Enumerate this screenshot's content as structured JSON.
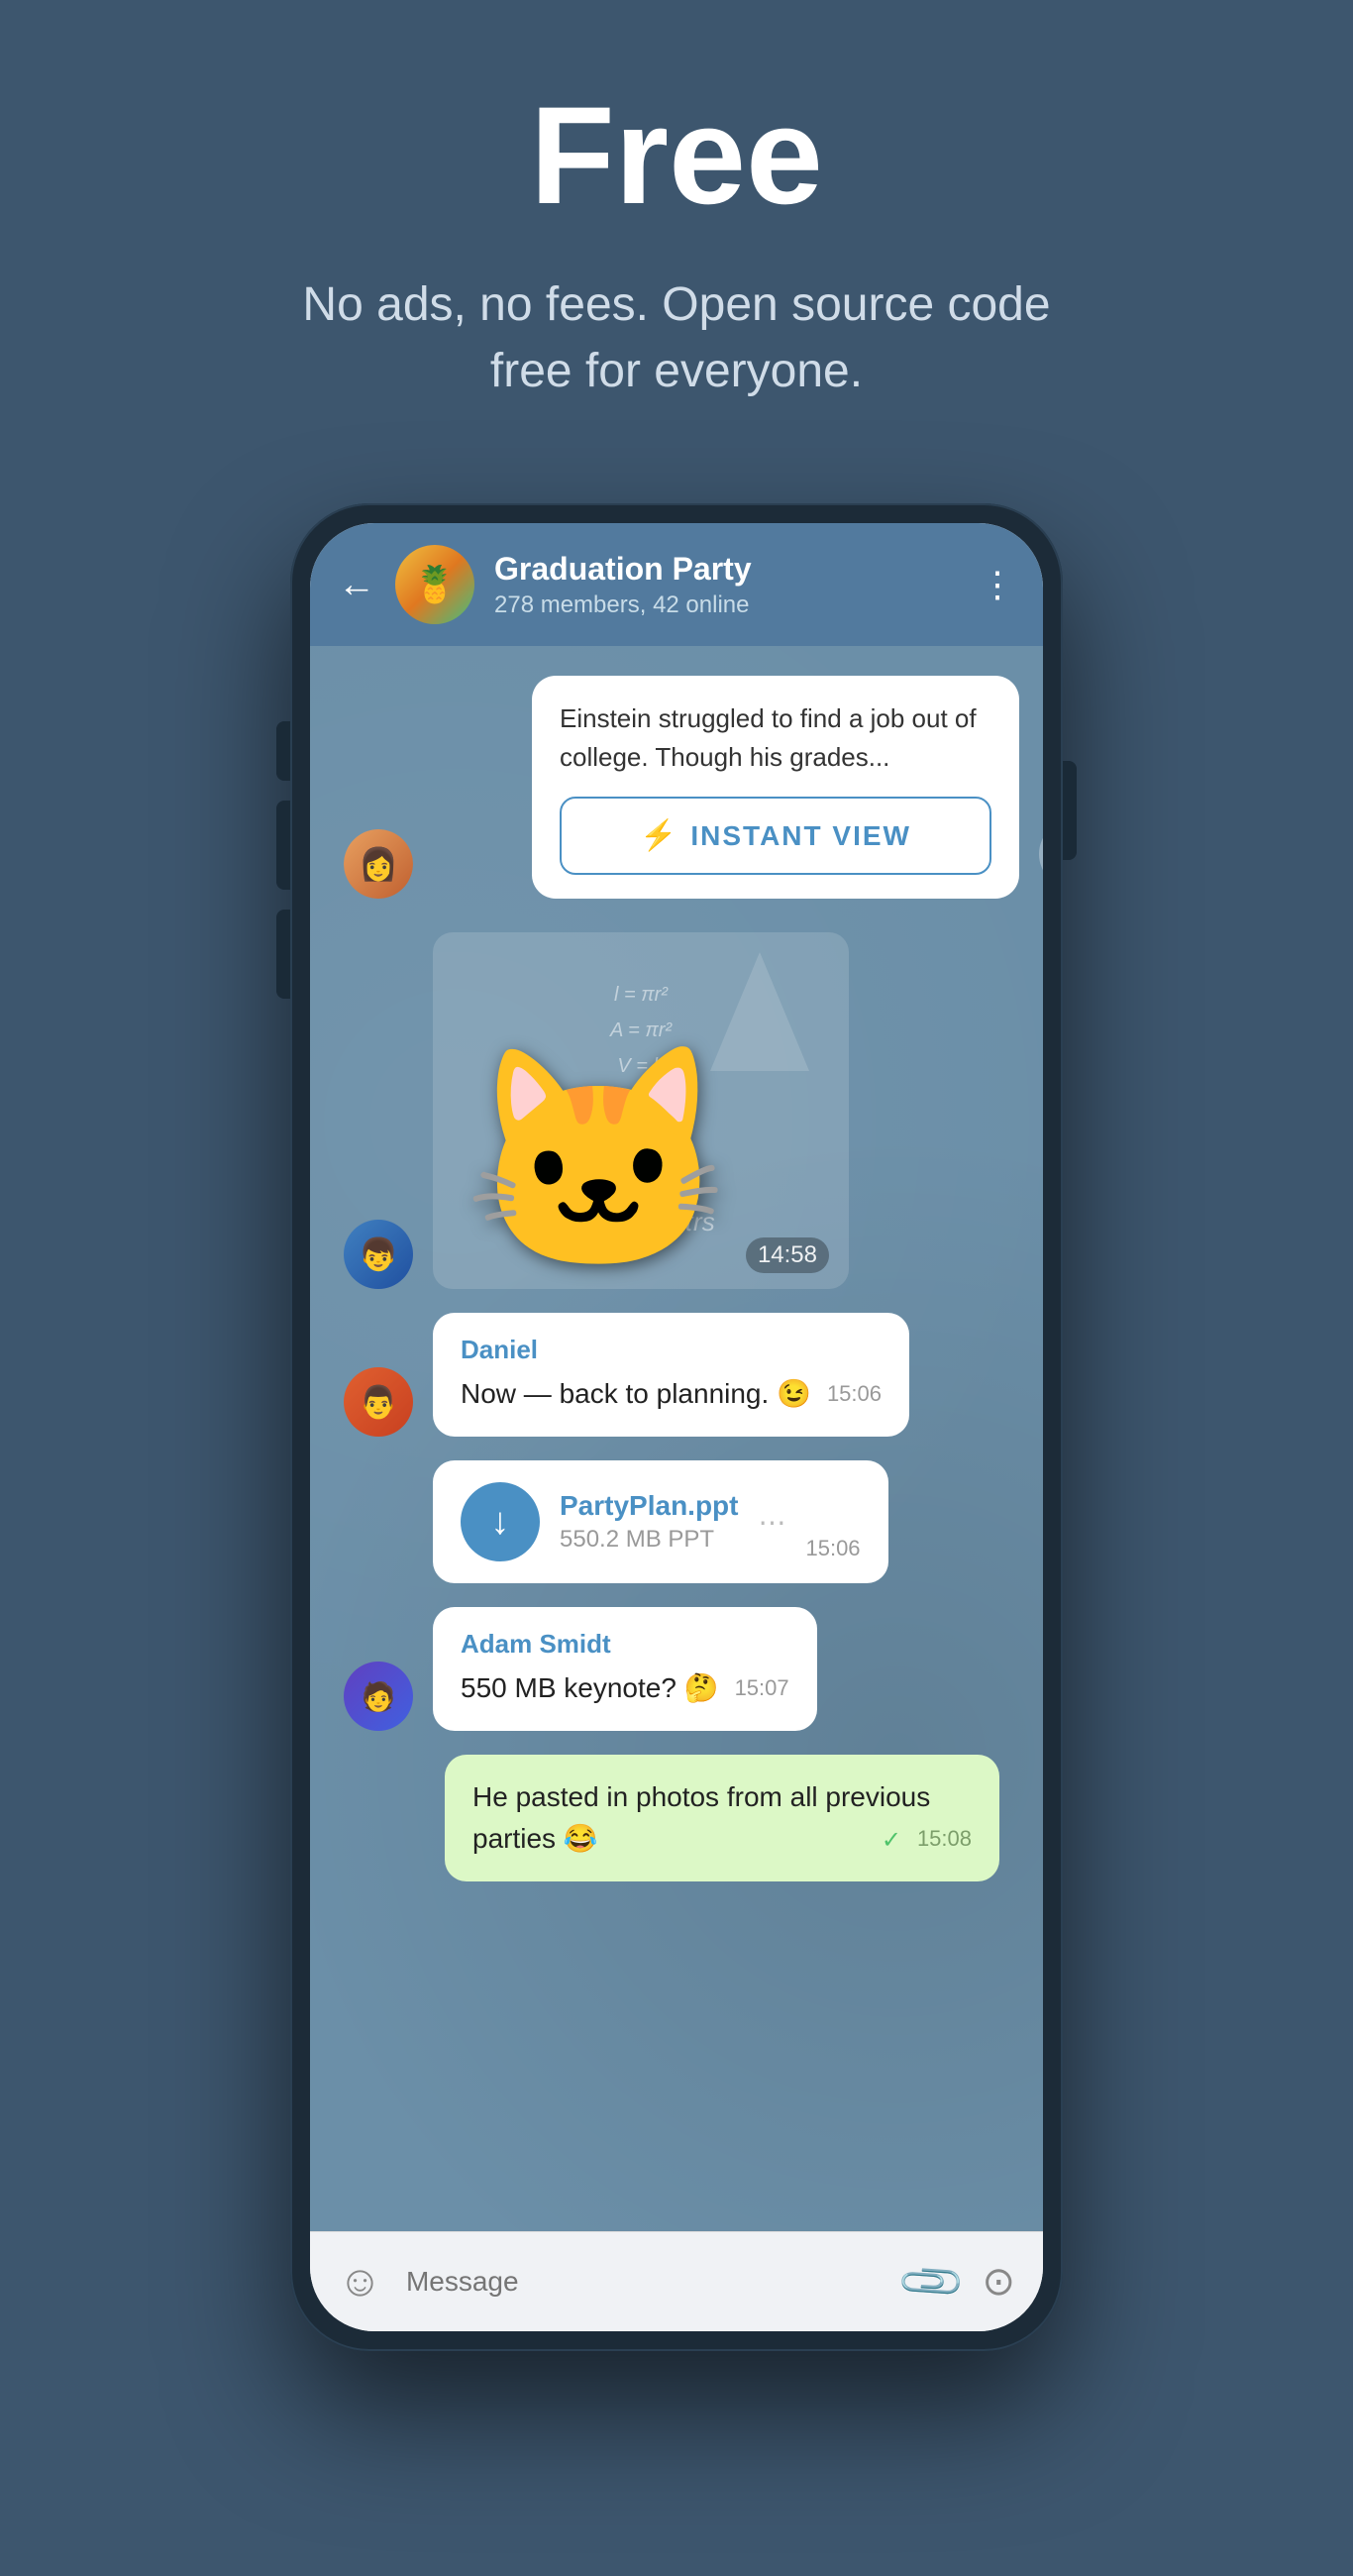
{
  "hero": {
    "title": "Free",
    "subtitle": "No ads, no fees. Open source code free for everyone."
  },
  "phone": {
    "header": {
      "group_name": "Graduation Party",
      "group_meta": "278 members, 42 online",
      "back_label": "←",
      "more_label": "⋮",
      "avatar_emoji": "🍍"
    },
    "messages": [
      {
        "id": "instant-view",
        "type": "instant_view",
        "text": "Einstein struggled to find a job out of college. Though his grades...",
        "button_label": "INSTANT VIEW"
      },
      {
        "id": "sticker",
        "type": "sticker",
        "time": "14:58"
      },
      {
        "id": "daniel-msg",
        "type": "text",
        "sender": "Daniel",
        "text": "Now — back to planning. 😉",
        "time": "15:06"
      },
      {
        "id": "file-msg",
        "type": "file",
        "filename": "PartyPlan.ppt",
        "size": "550.2 MB PPT",
        "time": "15:06"
      },
      {
        "id": "adam-msg",
        "type": "text",
        "sender": "Adam Smidt",
        "text": "550 MB keynote? 🤔",
        "time": "15:07"
      },
      {
        "id": "own-msg",
        "type": "own",
        "text": "He pasted in photos from all previous parties 😂",
        "time": "15:08",
        "read": true
      }
    ],
    "input": {
      "placeholder": "Message"
    }
  }
}
